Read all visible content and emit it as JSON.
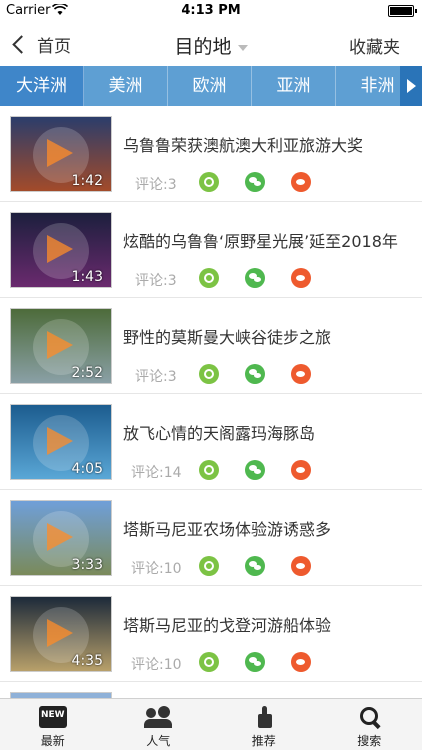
{
  "status": {
    "carrier": "Carrier",
    "time": "4:13 PM"
  },
  "nav": {
    "back_label": "首页",
    "title": "目的地",
    "right_label": "收藏夹"
  },
  "categories": [
    "大洋洲",
    "美洲",
    "欧洲",
    "亚洲",
    "非洲"
  ],
  "active_category": "大洋洲",
  "items": [
    {
      "title": "乌鲁鲁荣获澳航澳大利亚旅游大奖",
      "duration": "1:42",
      "comments": "评论:3",
      "thumb": [
        "#2b3d6b",
        "#a34b2a"
      ]
    },
    {
      "title": "炫酷的乌鲁鲁‘原野星光展’延至2018年",
      "duration": "1:43",
      "comments": "评论:3",
      "thumb": [
        "#1c1f3d",
        "#6a2a6e"
      ]
    },
    {
      "title": "野性的莫斯曼大峡谷徒步之旅",
      "duration": "2:52",
      "comments": "评论:3",
      "thumb": [
        "#4d6b3a",
        "#8aa0a6"
      ]
    },
    {
      "title": "放飞心情的天阁露玛海豚岛",
      "duration": "4:05",
      "comments": "评论:14",
      "thumb": [
        "#1c5c8f",
        "#5aa7d6"
      ]
    },
    {
      "title": "塔斯马尼亚农场体验游诱惑多",
      "duration": "3:33",
      "comments": "评论:10",
      "thumb": [
        "#6f9fd9",
        "#7a8a5a"
      ]
    },
    {
      "title": "塔斯马尼亚的戈登河游船体验",
      "duration": "4:35",
      "comments": "评论:10",
      "thumb": [
        "#1d2a3a",
        "#b8a06a"
      ]
    }
  ],
  "tabs": [
    {
      "label": "最新",
      "icon": "new-icon",
      "badge": "NEW"
    },
    {
      "label": "人气",
      "icon": "people-icon"
    },
    {
      "label": "推荐",
      "icon": "thumbs-up-icon"
    },
    {
      "label": "搜索",
      "icon": "search-icon"
    }
  ]
}
